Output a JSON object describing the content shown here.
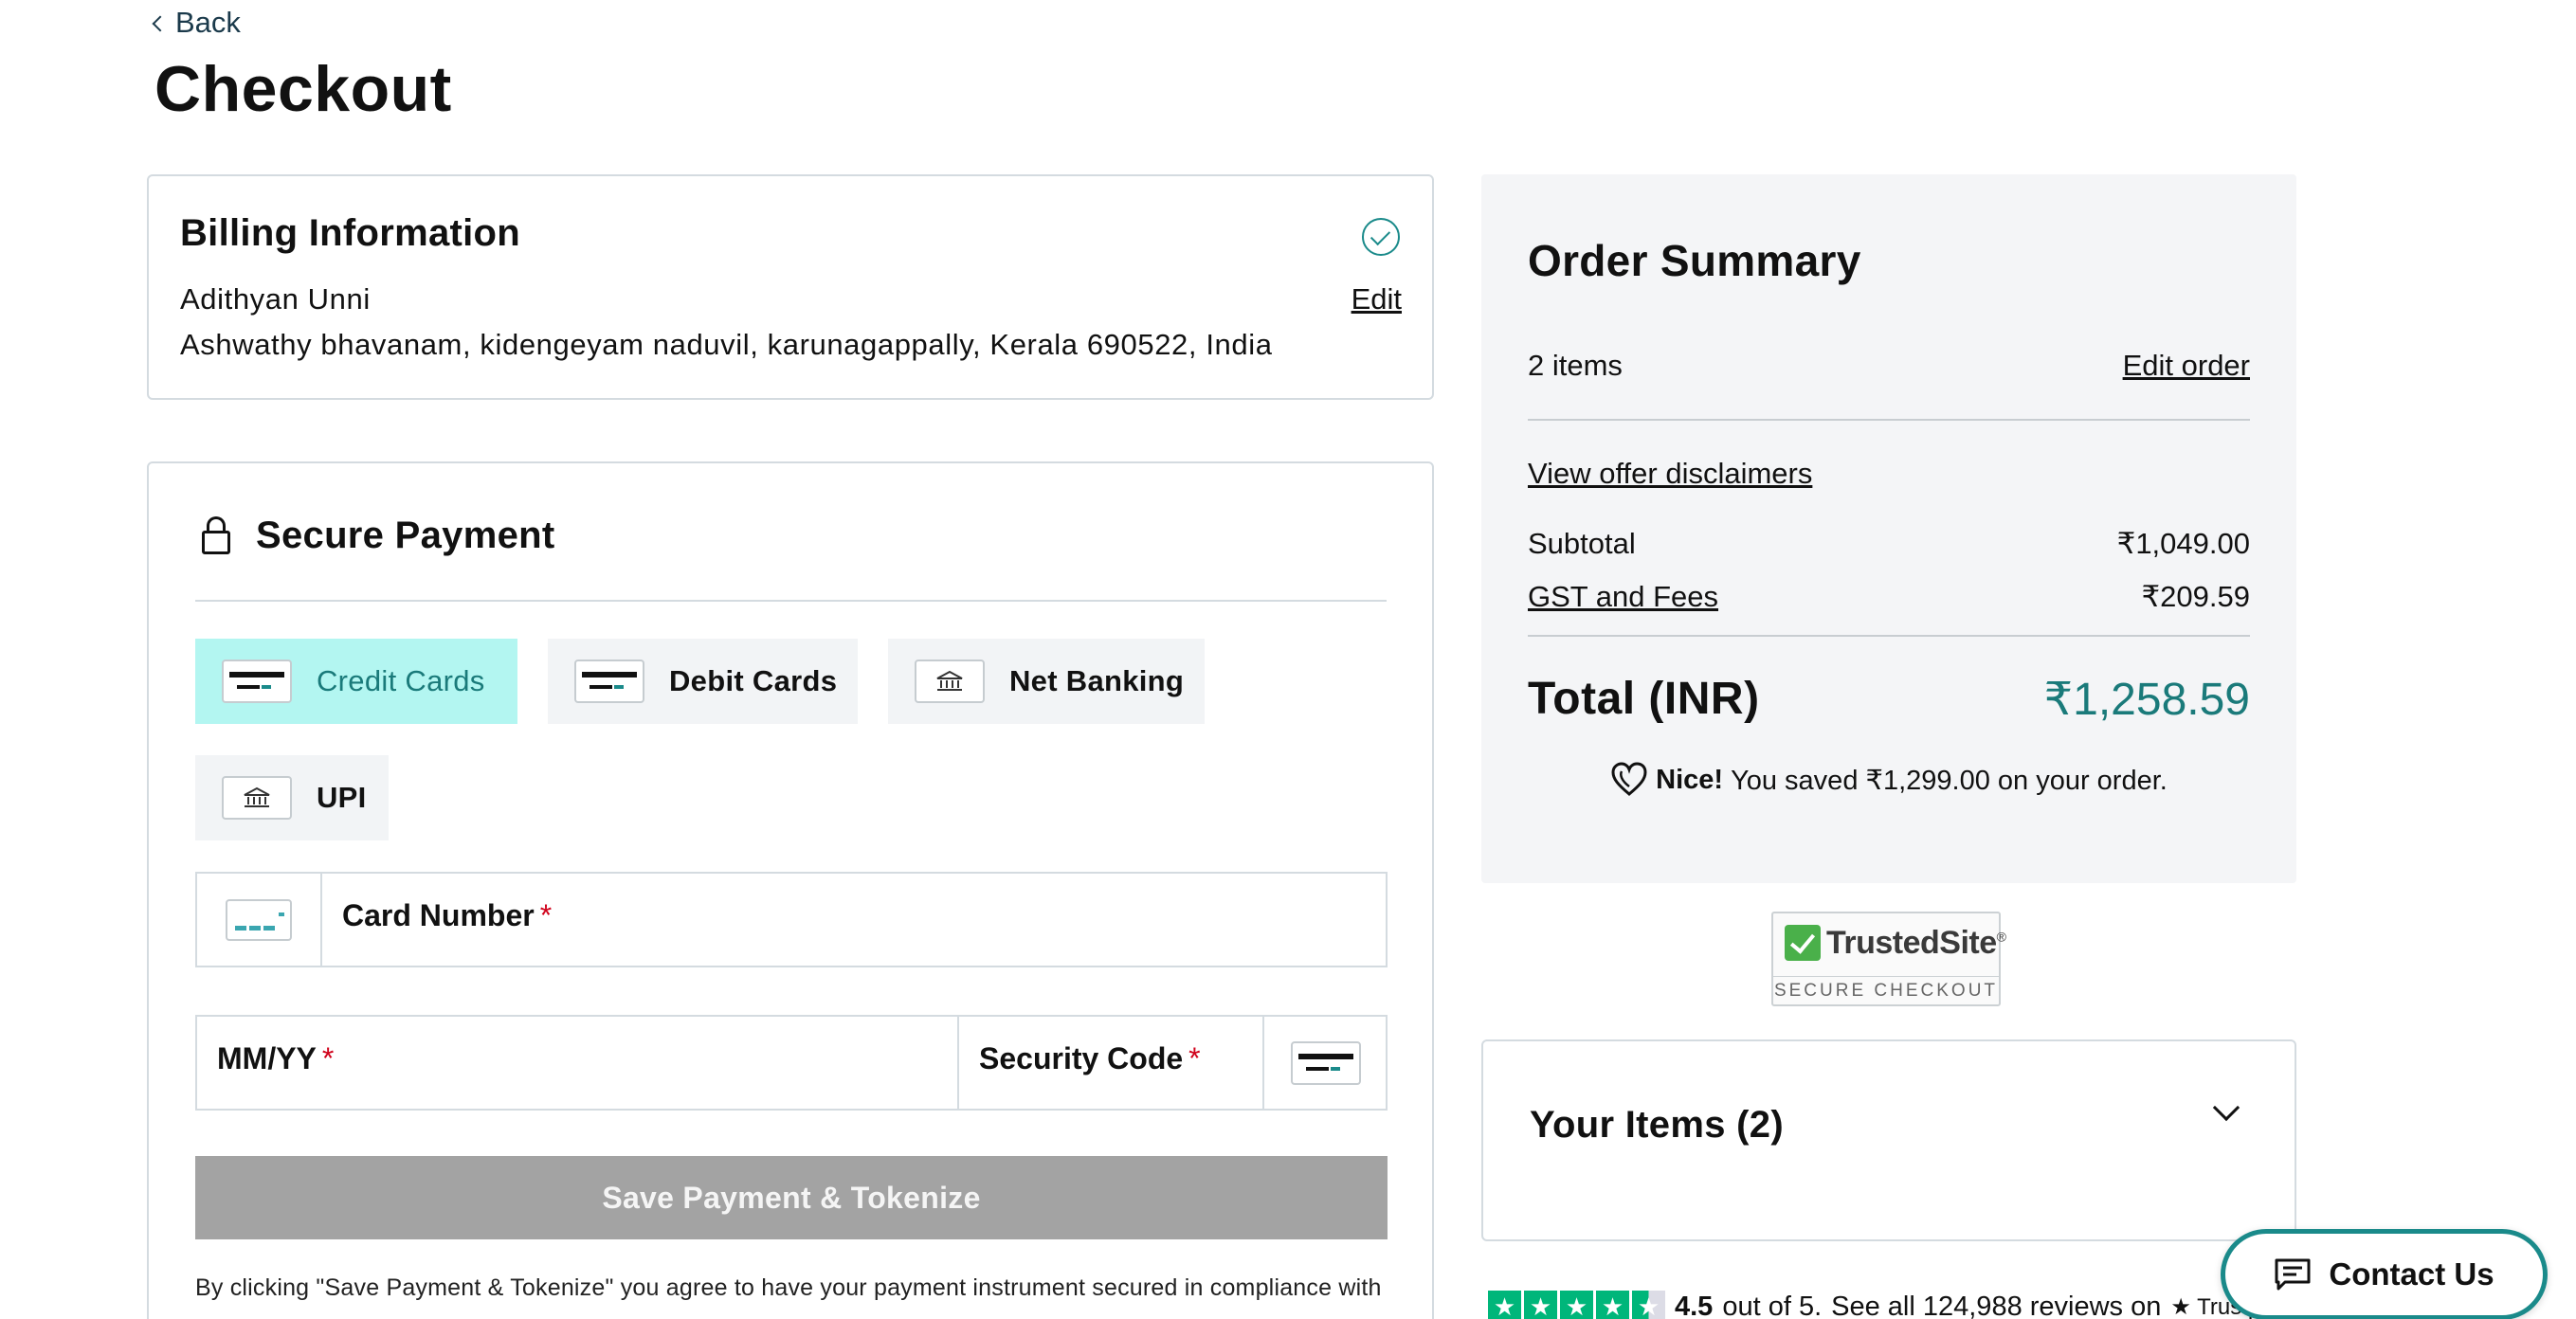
{
  "nav": {
    "back_label": "Back"
  },
  "page": {
    "title": "Checkout"
  },
  "billing": {
    "title": "Billing Information",
    "name": "Adithyan Unni",
    "address": "Ashwathy bhavanam, kidengeyam naduvil, karunagappally, Kerala 690522, India",
    "edit_label": "Edit"
  },
  "payment": {
    "title": "Secure Payment",
    "methods": [
      {
        "label": "Credit Cards",
        "icon": "credit-card-icon",
        "active": true
      },
      {
        "label": "Debit Cards",
        "icon": "debit-card-icon",
        "active": false
      },
      {
        "label": "Net Banking",
        "icon": "bank-icon",
        "active": false
      },
      {
        "label": "UPI",
        "icon": "bank-icon",
        "active": false
      }
    ],
    "card_number_label": "Card Number",
    "expiry_label": "MM/YY",
    "security_code_label": "Security Code",
    "required_mark": "*",
    "save_button": "Save Payment & Tokenize",
    "terms_text": "By clicking \"Save Payment & Tokenize\" you agree to have your payment instrument secured in compliance with"
  },
  "summary": {
    "title": "Order Summary",
    "items_count": "2 items",
    "edit_order": "Edit order",
    "offer_link": "View offer disclaimers",
    "subtotal_label": "Subtotal",
    "subtotal_value": "₹1,049.00",
    "gst_label": "GST and Fees",
    "gst_value": "₹209.59",
    "total_label": "Total (INR)",
    "total_value": "₹1,258.59",
    "saved_bold": "Nice!",
    "saved_text": "You saved ₹1,299.00 on your order."
  },
  "trusted": {
    "name": "TrustedSite",
    "sub": "SECURE CHECKOUT",
    "reg": "®"
  },
  "your_items": {
    "title": "Your Items (2)"
  },
  "trustpilot": {
    "rating": "4.5",
    "rating_text": "out of 5.",
    "reviews_text": "See all 124,988 reviews on",
    "brand": "Trustpilot"
  },
  "contact": {
    "label": "Contact Us"
  },
  "colors": {
    "accent": "#1a8a8a",
    "active_tab_bg": "#b3f6f1",
    "button_disabled": "#a3a3a3",
    "trustpilot_green": "#00b67a"
  }
}
